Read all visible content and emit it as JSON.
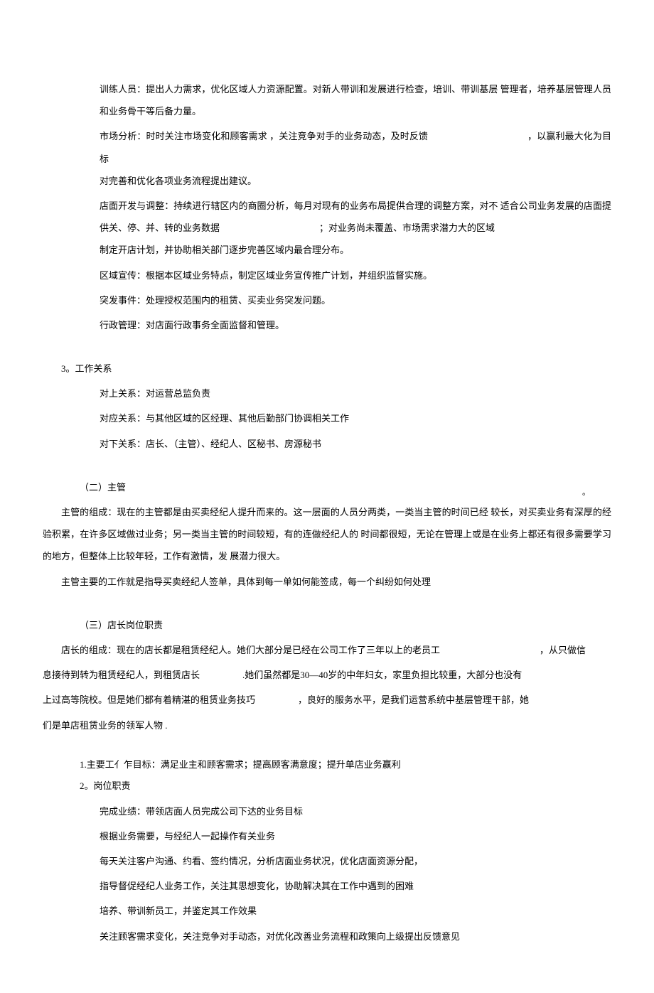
{
  "para": {
    "train": "训练人员：提出人力需求，优化区域人力资源配置。对新人带训和发展进行检查，培训、带训基层 管理者，培养基层管理人员和业务骨干等后备力量。",
    "market_a": "市场分析：时时关注市场变化和顾客需求 ，关注竞争对手的业务动态，及时反馈",
    "market_b": "，以赢利最大化为目标",
    "market_c": "对完善和优化各项业务流程提出建议。",
    "store_a": "店面开发与调整：持续进行辖区内的商圈分析，每月对现有的业务布局提供合理的调整方案，对不 适合公司业务发展的店面提供关、停、并、转的业务数据",
    "store_b": "；对业务尚未覆盖、市场需求潜力大的区域",
    "store_c": "制定开店计划，并协助相关部门逐步完善区域内最合理分布。",
    "zone": "区域宣传：根据本区域业务特点，制定区域业务宣传推广计划，并组织监督实施。",
    "emerg": "突发事件：处理授权范围内的租赁、买卖业务突发问题。",
    "admin": "行政管理：对店面行政事务全面监督和管理。",
    "s3_title": "3。工作关系",
    "rel_up": "对上关系：对运营总监负责",
    "rel_peer": "对应关系：与其他区域的区经理、其他后勤部门协调相关工作",
    "rel_down": "对下关系：店长、（主管）、经纪人、区秘书、房源秘书",
    "sec2_title": "（二）主管",
    "sec2_p1": "主管的组成：现在的主管都是由买卖经纪人提升而来的。这一层面的人员分两类，一类当主管的时间已经 较长，对买卖业务有深厚的经验积累，在许多区域做过业务；另一类当主管的时间较短，有的连做经纪人的 时间都很短，无论在管理上或是在业务上都还有很多需要学习的地方，但整体上比较年轻，工作有激情，发 展潜力很大。",
    "sec2_p2": "主管主要的工作就是指导买卖经纪人签单，具体到每一单如何能签成，每一个纠纷如何处理",
    "sec3_title": "（三）店长岗位职责",
    "sec3_p1_a": "店长的组成：现在的店长都是租赁经纪人。她们大部分是已经在公司工作了三年以上的老员工",
    "sec3_p1_b": "，从只做信",
    "sec3_p2_a": "息接待到转为租赁经纪人，到租赁店长",
    "sec3_p2_b": ".她们虽然都是30—40岁的中年妇女，家里负担比较重，大部分也没有",
    "sec3_p3_a": "上过高等院校。但是她们都有着精湛的租赁业务技巧",
    "sec3_p3_b": "，良好的服务水平，是我们运营系统中基层管理干部，她",
    "sec3_p4": "们是单店租赁业务的领军人物 .",
    "sec3_s1": "1.主要工亻乍目标：满足业主和顾客需求；提高顾客满意度；提升单店业务赢利",
    "sec3_s2": "2。岗位职责",
    "duty1": "完成业绩：带领店面人员完成公司下达的业务目标",
    "duty2": "根据业务需要，与经纪人一起操作有关业务",
    "duty3": "每天关注客户沟通、约看、签约情况，分析店面业务状况，优化店面资源分配，",
    "duty4": "指导督促经纪人业务工作，关注其思想变化，协助解决其在工作中遇到的困难",
    "duty5": "培养、带训新员工，并鉴定其工作效果",
    "duty6": "关注顾客需求变化，关注竞争对手动态，对优化改善业务流程和政策向上级提出反馈意见"
  }
}
